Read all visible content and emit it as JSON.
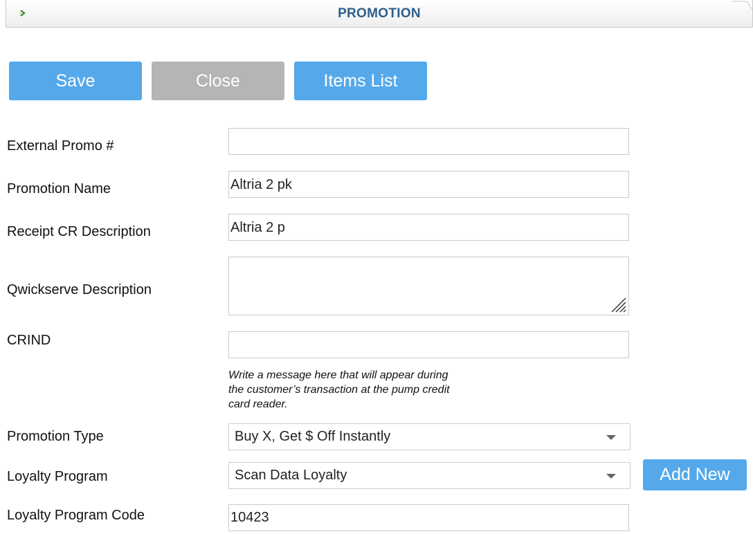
{
  "header": {
    "title": "PROMOTION"
  },
  "toolbar": {
    "save_label": "Save",
    "close_label": "Close",
    "items_list_label": "Items List"
  },
  "form": {
    "external_promo": {
      "label": "External Promo #",
      "value": ""
    },
    "promotion_name": {
      "label": "Promotion Name",
      "value": "Altria 2 pk"
    },
    "receipt_cr": {
      "label": "Receipt CR Description",
      "value": "Altria 2 p"
    },
    "qwickserve": {
      "label": "Qwickserve Description",
      "value": ""
    },
    "crind": {
      "label": "CRIND",
      "value": "",
      "hint_line1": "Write a message here that will appear during",
      "hint_line2": "the customer’s transaction at the pump credit",
      "hint_line3": "card reader."
    },
    "promotion_type": {
      "label": "Promotion Type",
      "selected": "Buy X, Get $ Off Instantly"
    },
    "loyalty_program": {
      "label": "Loyalty Program",
      "selected": "Scan Data Loyalty",
      "add_new_label": "Add New"
    },
    "loyalty_program_code": {
      "label": "Loyalty Program Code",
      "value": "10423"
    }
  },
  "colors": {
    "accent": "#55a9ea",
    "disabled": "#b5b5b5",
    "title": "#2c5f8e"
  }
}
